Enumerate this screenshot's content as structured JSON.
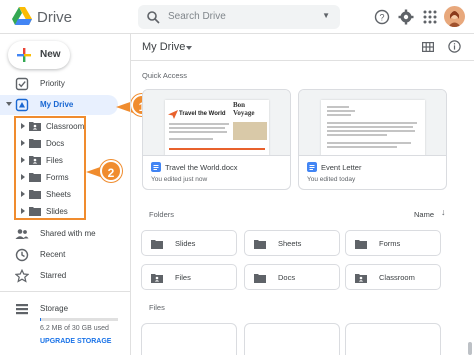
{
  "header": {
    "app_title": "Drive",
    "search_placeholder": "Search Drive",
    "icons": [
      "drive-logo-icon",
      "search-icon",
      "caret-down-icon",
      "help-icon",
      "gear-icon",
      "apps-grid-icon"
    ]
  },
  "sidebar": {
    "new_label": "New",
    "items": [
      {
        "label": "Priority",
        "icon": "checkbox-icon"
      },
      {
        "label": "My Drive",
        "icon": "drive-icon"
      },
      {
        "label": "Shared with me",
        "icon": "people-icon"
      },
      {
        "label": "Recent",
        "icon": "clock-icon"
      },
      {
        "label": "Starred",
        "icon": "star-icon"
      },
      {
        "label": "Storage",
        "icon": "storage-icon"
      }
    ],
    "tree": [
      {
        "label": "Classroom",
        "icon": "shared-folder-icon"
      },
      {
        "label": "Docs",
        "icon": "folder-icon"
      },
      {
        "label": "Files",
        "icon": "shared-folder-icon"
      },
      {
        "label": "Forms",
        "icon": "folder-icon"
      },
      {
        "label": "Sheets",
        "icon": "folder-icon"
      },
      {
        "label": "Slides",
        "icon": "folder-icon"
      }
    ],
    "callouts": [
      "1",
      "2"
    ],
    "storage_text": "6.2 MB of 30 GB used",
    "storage_fraction": 0.0002,
    "upgrade_label": "UPGRADE STORAGE"
  },
  "main": {
    "title": "My Drive",
    "quick_access_title": "Quick Access",
    "quick_access": [
      {
        "name": "Travel the World.docx",
        "sub": "You edited just now",
        "thumb_title": "Travel the World",
        "thumb_headline": "Bon Voyage",
        "type_color": "#4285f4"
      },
      {
        "name": "Event Letter",
        "sub": "You edited today",
        "type_color": "#4285f4"
      }
    ],
    "folders_title": "Folders",
    "sort_label": "Name",
    "folders": [
      {
        "label": "Slides",
        "icon": "folder-icon"
      },
      {
        "label": "Sheets",
        "icon": "folder-icon"
      },
      {
        "label": "Forms",
        "icon": "folder-icon"
      },
      {
        "label": "Files",
        "icon": "shared-folder-icon"
      },
      {
        "label": "Docs",
        "icon": "folder-icon"
      },
      {
        "label": "Classroom",
        "icon": "shared-folder-icon"
      }
    ],
    "files_title": "Files"
  },
  "colors": {
    "accent": "#1a73e8",
    "active_bg": "#e8f0fe",
    "callout": "#f08c2e"
  }
}
